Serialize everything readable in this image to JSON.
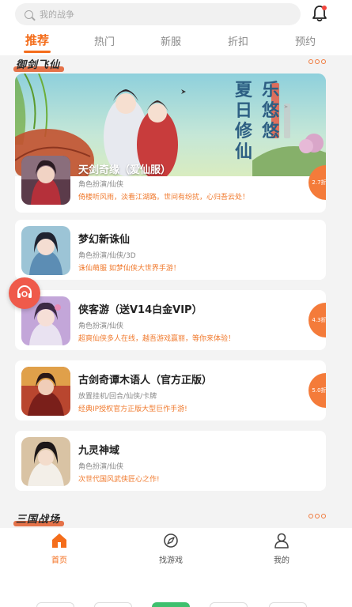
{
  "search": {
    "placeholder": "我的战争"
  },
  "tabs": [
    {
      "label": "推荐",
      "active": true
    },
    {
      "label": "热门"
    },
    {
      "label": "新服"
    },
    {
      "label": "折扣"
    },
    {
      "label": "预约"
    }
  ],
  "sections": {
    "first": {
      "title": "御剑飞仙"
    },
    "second": {
      "title": "三国战场"
    }
  },
  "banner": {
    "calligraphy": [
      "夏日修仙",
      "乐悠悠"
    ]
  },
  "games": [
    {
      "title": "天剑奇缘（爱仙服）",
      "tags": "角色扮演/仙侠",
      "desc": "倚楼听风雨，淡看江湖路。世间有纷扰，心归吾云处！",
      "discount": "2.7折"
    },
    {
      "title": "梦幻新诛仙",
      "tags": "角色扮演/仙侠/3D",
      "desc": "诛仙萌服 如梦仙侠大世界手游！",
      "discount": ""
    },
    {
      "title": "侠客游（送V14白金VIP）",
      "tags": "角色扮演/仙侠",
      "desc": "超爽仙侠多人在线，越吾游戏赢丽，等你来体验！",
      "discount": "4.3折"
    },
    {
      "title": "古剑奇谭木语人（官方正版）",
      "tags": "放置挂机/回合/仙侠/卡牌",
      "desc": "经典IP授权官方正版大型巨作手游!",
      "discount": "5.0折"
    },
    {
      "title": "九灵神域",
      "tags": "角色扮演/仙侠",
      "desc": "次世代国风武侠匠心之作!",
      "discount": ""
    }
  ],
  "nav": [
    {
      "label": "首页",
      "icon": "home-icon",
      "active": true
    },
    {
      "label": "找游戏",
      "icon": "compass-icon"
    },
    {
      "label": "我的",
      "icon": "user-icon"
    }
  ],
  "colors": {
    "accent": "#f46d1b",
    "discount": "#f47b3a",
    "desc": "#f07a2e",
    "service": "#ef5a4b"
  }
}
